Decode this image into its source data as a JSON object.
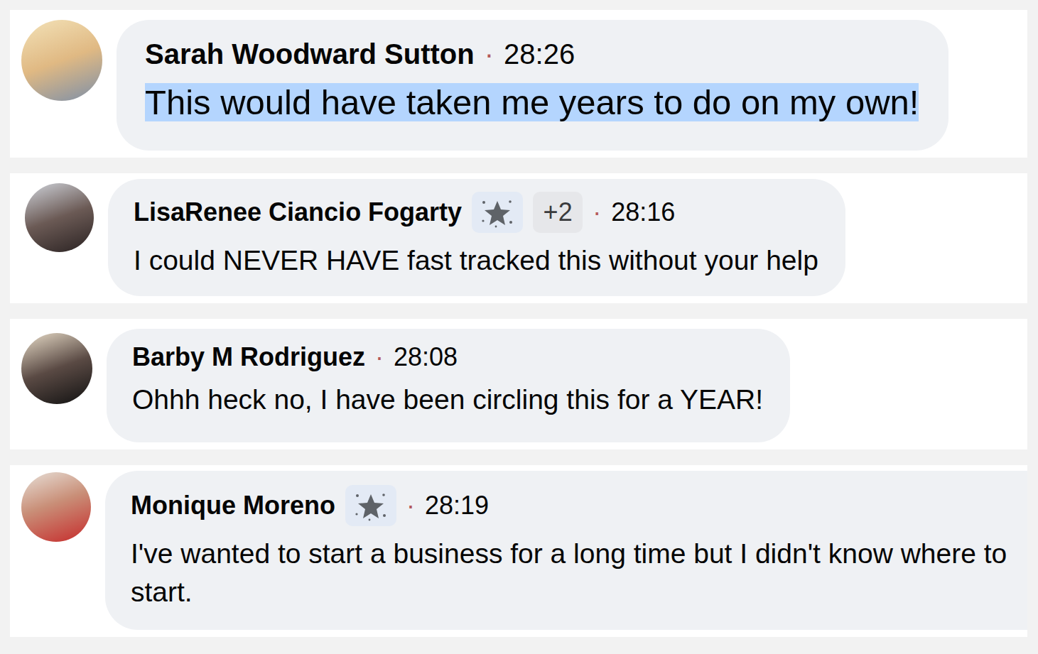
{
  "comments": [
    {
      "author": "Sarah Woodward Sutton",
      "separator": "·",
      "time": "28:26",
      "text": "This would have taken me years to do on my own!",
      "highlighted": true,
      "badges": []
    },
    {
      "author": "LisaRenee Ciancio Fogarty",
      "separator": "·",
      "time": "28:16",
      "text": "I could NEVER HAVE fast tracked this without your help",
      "highlighted": false,
      "badges": [
        {
          "kind": "icon"
        },
        {
          "kind": "count",
          "label": "+2"
        }
      ]
    },
    {
      "author": "Barby M Rodriguez",
      "separator": "·",
      "time": "28:08",
      "text": "Ohhh heck no, I have been circling this for a YEAR!",
      "highlighted": false,
      "badges": []
    },
    {
      "author": "Monique Moreno",
      "separator": "·",
      "time": "28:19",
      "text": "I've wanted to start a business for a long time but I didn't know where to start.",
      "highlighted": false,
      "badges": [
        {
          "kind": "icon"
        }
      ]
    }
  ]
}
